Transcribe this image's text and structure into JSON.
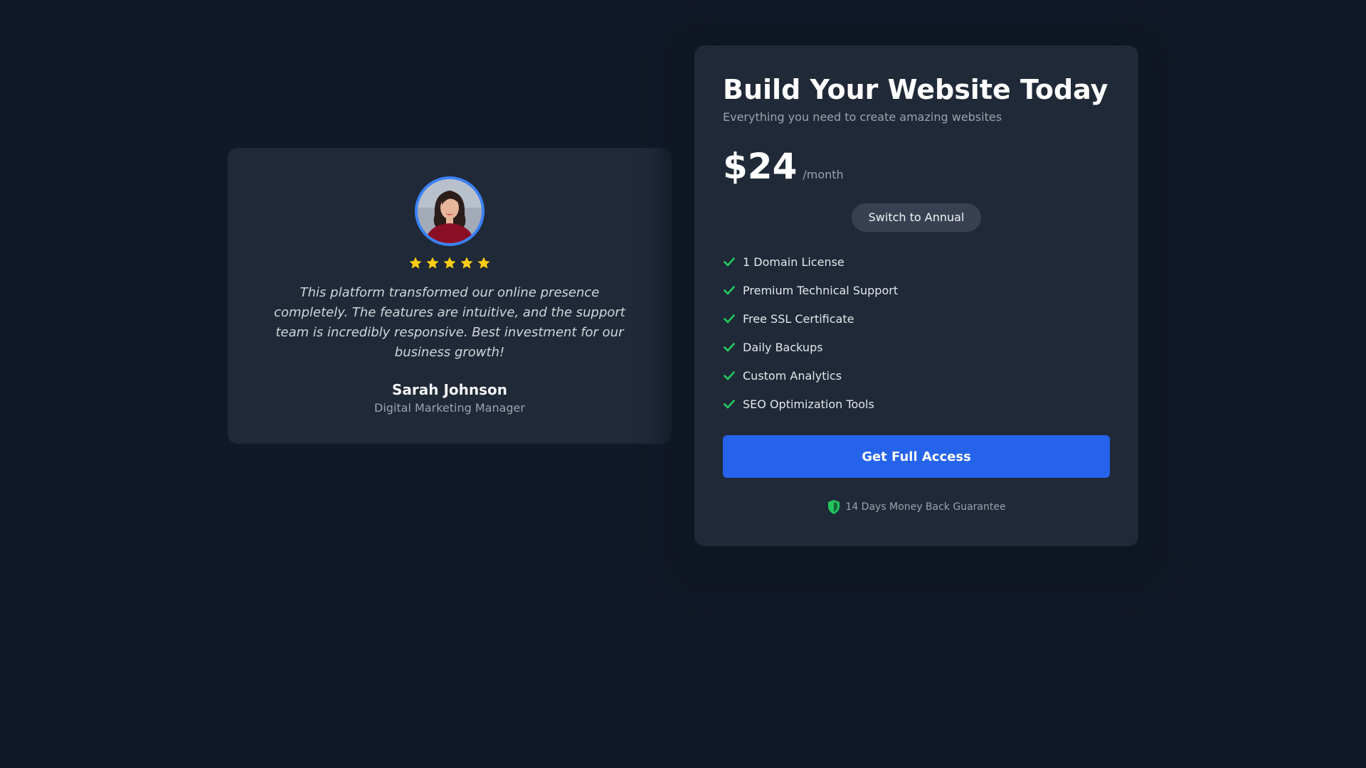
{
  "colors": {
    "background": "#111827",
    "card": "#1f2937",
    "accent_blue": "#2563eb",
    "avatar_ring": "#3b82f6",
    "star": "#facc15",
    "check_green": "#22c55e"
  },
  "testimonial": {
    "avatar_icon": "avatar-photo",
    "rating": 5,
    "rating_max": 5,
    "star_icon": "star-icon",
    "quote": "This platform transformed our online presence completely. The features are intuitive, and the support team is incredibly responsive. Best investment for our business growth!",
    "author_name": "Sarah Johnson",
    "author_role": "Digital Marketing Manager"
  },
  "pricing": {
    "title": "Build Your Website Today",
    "subtitle": "Everything you need to create amazing websites",
    "price": "$24",
    "period": "/month",
    "toggle_label": "Switch to Annual",
    "feature_icon": "check-icon",
    "features": [
      "1 Domain License",
      "Premium Technical Support",
      "Free SSL Certificate",
      "Daily Backups",
      "Custom Analytics",
      "SEO Optimization Tools"
    ],
    "cta_label": "Get Full Access",
    "guarantee_icon": "shield-icon",
    "guarantee_text": "14 Days Money Back Guarantee"
  }
}
